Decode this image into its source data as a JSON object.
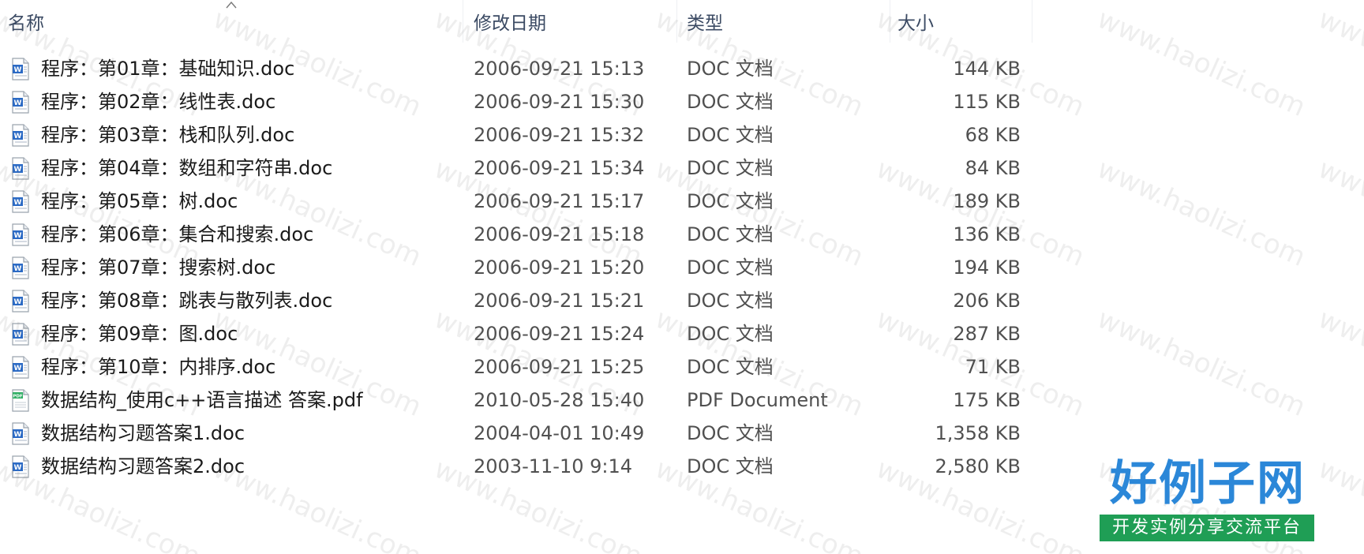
{
  "columns": {
    "name": "名称",
    "date": "修改日期",
    "type": "类型",
    "size": "大小"
  },
  "files": [
    {
      "name": "程序：第01章：基础知识.doc",
      "date": "2006-09-21 15:13",
      "type": "DOC 文档",
      "size": "144 KB",
      "icon": "word-doc-icon"
    },
    {
      "name": "程序：第02章：线性表.doc",
      "date": "2006-09-21 15:30",
      "type": "DOC 文档",
      "size": "115 KB",
      "icon": "word-doc-icon"
    },
    {
      "name": "程序：第03章：栈和队列.doc",
      "date": "2006-09-21 15:32",
      "type": "DOC 文档",
      "size": "68 KB",
      "icon": "word-doc-icon"
    },
    {
      "name": "程序：第04章：数组和字符串.doc",
      "date": "2006-09-21 15:34",
      "type": "DOC 文档",
      "size": "84 KB",
      "icon": "word-doc-icon"
    },
    {
      "name": "程序：第05章：树.doc",
      "date": "2006-09-21 15:17",
      "type": "DOC 文档",
      "size": "189 KB",
      "icon": "word-doc-icon"
    },
    {
      "name": "程序：第06章：集合和搜索.doc",
      "date": "2006-09-21 15:18",
      "type": "DOC 文档",
      "size": "136 KB",
      "icon": "word-doc-icon"
    },
    {
      "name": "程序：第07章：搜索树.doc",
      "date": "2006-09-21 15:20",
      "type": "DOC 文档",
      "size": "194 KB",
      "icon": "word-doc-icon"
    },
    {
      "name": "程序：第08章：跳表与散列表.doc",
      "date": "2006-09-21 15:21",
      "type": "DOC 文档",
      "size": "206 KB",
      "icon": "word-doc-icon"
    },
    {
      "name": "程序：第09章：图.doc",
      "date": "2006-09-21 15:24",
      "type": "DOC 文档",
      "size": "287 KB",
      "icon": "word-doc-icon"
    },
    {
      "name": "程序：第10章：内排序.doc",
      "date": "2006-09-21 15:25",
      "type": "DOC 文档",
      "size": "71 KB",
      "icon": "word-doc-icon"
    },
    {
      "name": "数据结构_使用c++语言描述 答案.pdf",
      "date": "2010-05-28 15:40",
      "type": "PDF Document",
      "size": "175 KB",
      "icon": "pdf-icon"
    },
    {
      "name": "数据结构习题答案1.doc",
      "date": "2004-04-01 10:49",
      "type": "DOC 文档",
      "size": "1,358 KB",
      "icon": "word-doc-icon"
    },
    {
      "name": "数据结构习题答案2.doc",
      "date": "2003-11-10 9:14",
      "type": "DOC 文档",
      "size": "2,580 KB",
      "icon": "word-doc-icon"
    }
  ],
  "watermark": {
    "text": "www.haolizi.com",
    "logo_main": "好例子网",
    "logo_sub": "开发实例分享交流平台"
  },
  "colors": {
    "header_text": "#3b4a63",
    "logo_blue": "#2b87d8",
    "logo_green": "#1f9e55"
  }
}
